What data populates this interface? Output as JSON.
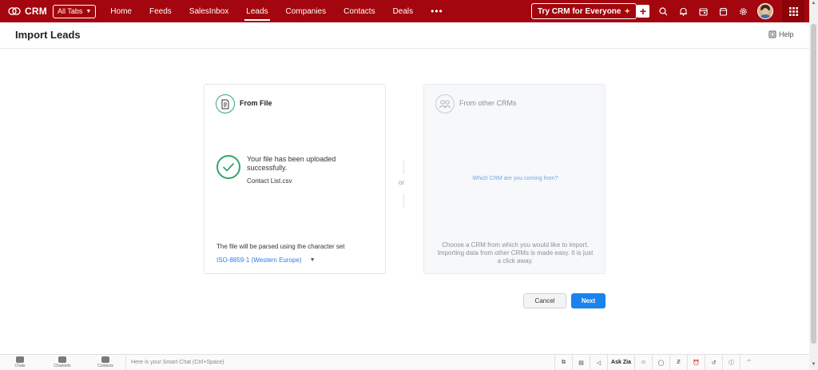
{
  "topnav": {
    "logo_text": "CRM",
    "all_tabs_label": "All Tabs",
    "links": [
      {
        "label": "Home",
        "active": false
      },
      {
        "label": "Feeds",
        "active": false
      },
      {
        "label": "SalesInbox",
        "active": false
      },
      {
        "label": "Leads",
        "active": true
      },
      {
        "label": "Companies",
        "active": false
      },
      {
        "label": "Contacts",
        "active": false
      },
      {
        "label": "Deals",
        "active": false
      }
    ],
    "more_label": "•••",
    "try_crm_label": "Try CRM for Everyone",
    "icons": [
      "plus-icon",
      "search-icon",
      "bell-icon",
      "calendar-icon",
      "marketplace-icon",
      "gear-icon"
    ],
    "brand_color": "#a3060e"
  },
  "page": {
    "title": "Import Leads",
    "help_label": "Help"
  },
  "from_file": {
    "title": "From File",
    "upload_message": "Your file has been uploaded successfully.",
    "file_name": "Contact List.csv",
    "charset_label": "The file will be parsed using the character set",
    "charset_value": "ISO-8859-1 (Western Europe)"
  },
  "divider": {
    "or_label": "or"
  },
  "from_crm": {
    "title": "From other CRMs",
    "question": "Which CRM are you coming from?",
    "description": "Choose a CRM from which you would like to import. Importing data from other CRMs is made easy. It is just a click away."
  },
  "actions": {
    "cancel_label": "Cancel",
    "next_label": "Next"
  },
  "bottombar": {
    "chats_label": "Chats",
    "channels_label": "Channels",
    "contacts_label": "Contacts",
    "smart_chat_placeholder": "Here is your Smart Chat (Ctrl+Space)",
    "ask_zia_label": "Ask Zia"
  }
}
